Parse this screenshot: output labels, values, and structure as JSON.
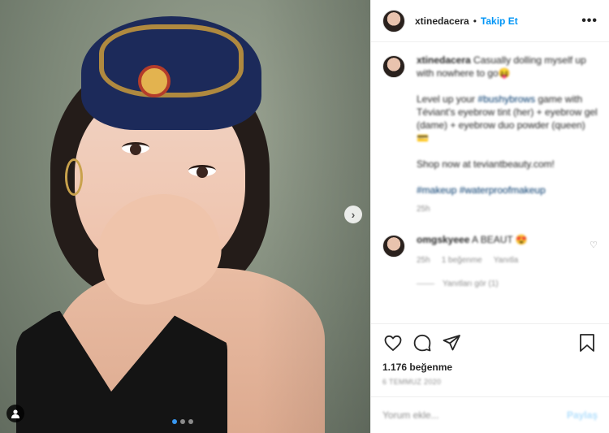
{
  "post": {
    "username": "xtinedacera",
    "separator": "•",
    "follow_label": "Takip Et",
    "more_label": "•••"
  },
  "caption": {
    "username": "xtinedacera",
    "line1": "Casually dolling myself up with nowhere to go😝",
    "line2_pre": "Level up your ",
    "line2_tag": "#bushybrows",
    "line2_post": " game with Téviant's eyebrow tint (her) + eyebrow gel (dame) + eyebrow duo powder (queen) 💳",
    "line3": "Shop now at teviantbeauty.com!",
    "hashtags": "#makeup #waterproofmakeup",
    "time": "25h"
  },
  "comment": {
    "username": "omgskyeee",
    "text": "A BEAUT 😍",
    "time": "25h",
    "likes": "1 beğenme",
    "reply_label": "Yanıtla",
    "view_replies": "Yanıtları gör (1)"
  },
  "actions": {
    "likes_count": "1.176 beğenme",
    "date": "6 TEMMUZ 2020"
  },
  "comment_box": {
    "placeholder": "Yorum ekle...",
    "post_label": "Paylaş"
  },
  "carousel": {
    "slides": 3,
    "active_index": 0
  },
  "colors": {
    "link_blue": "#0095f6",
    "active_dot": "#3897f0"
  }
}
